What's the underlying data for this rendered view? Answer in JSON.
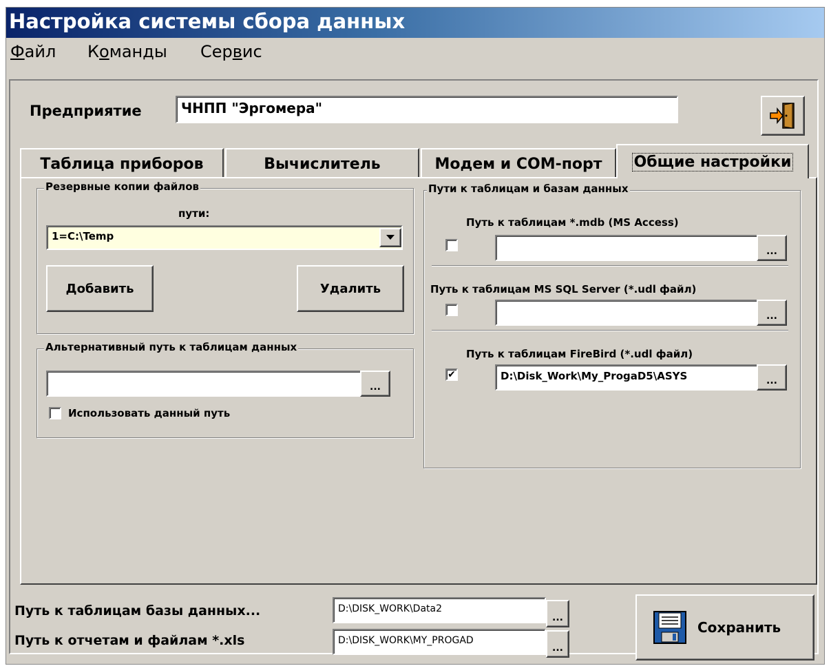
{
  "window": {
    "title": "Настройка системы сбора данных"
  },
  "menu": [
    {
      "pre": "",
      "u": "Ф",
      "post": "айл"
    },
    {
      "pre": "К",
      "u": "о",
      "post": "манды"
    },
    {
      "pre": "Сер",
      "u": "в",
      "post": "ис"
    }
  ],
  "company": {
    "label": "Предприятие",
    "value": "ЧНПП \"Эргомера\""
  },
  "tabs": [
    "Таблица приборов",
    "Вычислитель",
    "Модем и COM-порт",
    "Общие настройки"
  ],
  "backup": {
    "title": "Резервные копии файлов",
    "paths_label": "пути:",
    "selected": "1=C:\\Temp",
    "add_label": "Добавить",
    "delete_label": "Удалить"
  },
  "alt_path": {
    "title": "Альтернативный путь к таблицам данных",
    "value": "",
    "browse_label": "...",
    "use_label": "Использовать данный путь"
  },
  "db_paths": {
    "title": "Пути к таблицам и базам данных",
    "access": {
      "label": "Путь к таблицам *.mdb (MS Access)",
      "value": "",
      "checked": "",
      "browse_label": "..."
    },
    "mssql": {
      "label": "Путь к таблицам MS SQL Server (*.udl файл)",
      "value": "",
      "checked": "",
      "browse_label": "..."
    },
    "firebird": {
      "label": "Путь к таблицам FireBird (*.udl файл)",
      "value": "D:\\Disk_Work\\My_ProgaD5\\ASYS",
      "checked": "✔",
      "browse_label": "..."
    }
  },
  "bottom": {
    "db_label": "Путь к таблицам базы данных...",
    "db_value": "D:\\DISK_WORK\\Data2",
    "reports_label": "Путь к отчетам и файлам *.xls",
    "reports_value": "D:\\DISK_WORK\\MY_PROGAD",
    "browse_label": "...",
    "save_label": "Сохранить"
  },
  "icons": {
    "exit": "exit-door-icon",
    "save": "floppy-save-icon"
  }
}
